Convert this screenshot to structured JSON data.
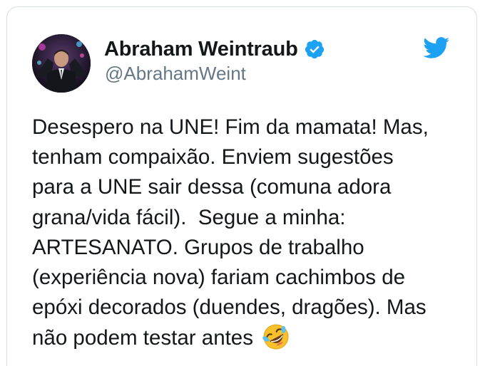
{
  "tweet": {
    "author": {
      "display_name": "Abraham Weintraub",
      "handle": "@AbrahamWeint",
      "verified": true,
      "avatar_icon": "user-avatar-photo"
    },
    "brand": {
      "logo_icon": "twitter-bird-icon",
      "color": "#1da1f2"
    },
    "text_lines": [
      "Desespero na UNE! Fim da mamata! Mas,",
      "tenham compaixão. Enviem sugestões",
      "para a UNE sair dessa (comuna adora",
      "grana/vida fácil).  Segue a minha:",
      "ARTESANATO. Grupos de trabalho",
      "(experiência nova) fariam cachimbos de",
      "epóxi decorados (duendes, dragões). Mas",
      "não podem testar antes"
    ],
    "emoji": "rolling-on-the-floor-laughing-emoji"
  }
}
